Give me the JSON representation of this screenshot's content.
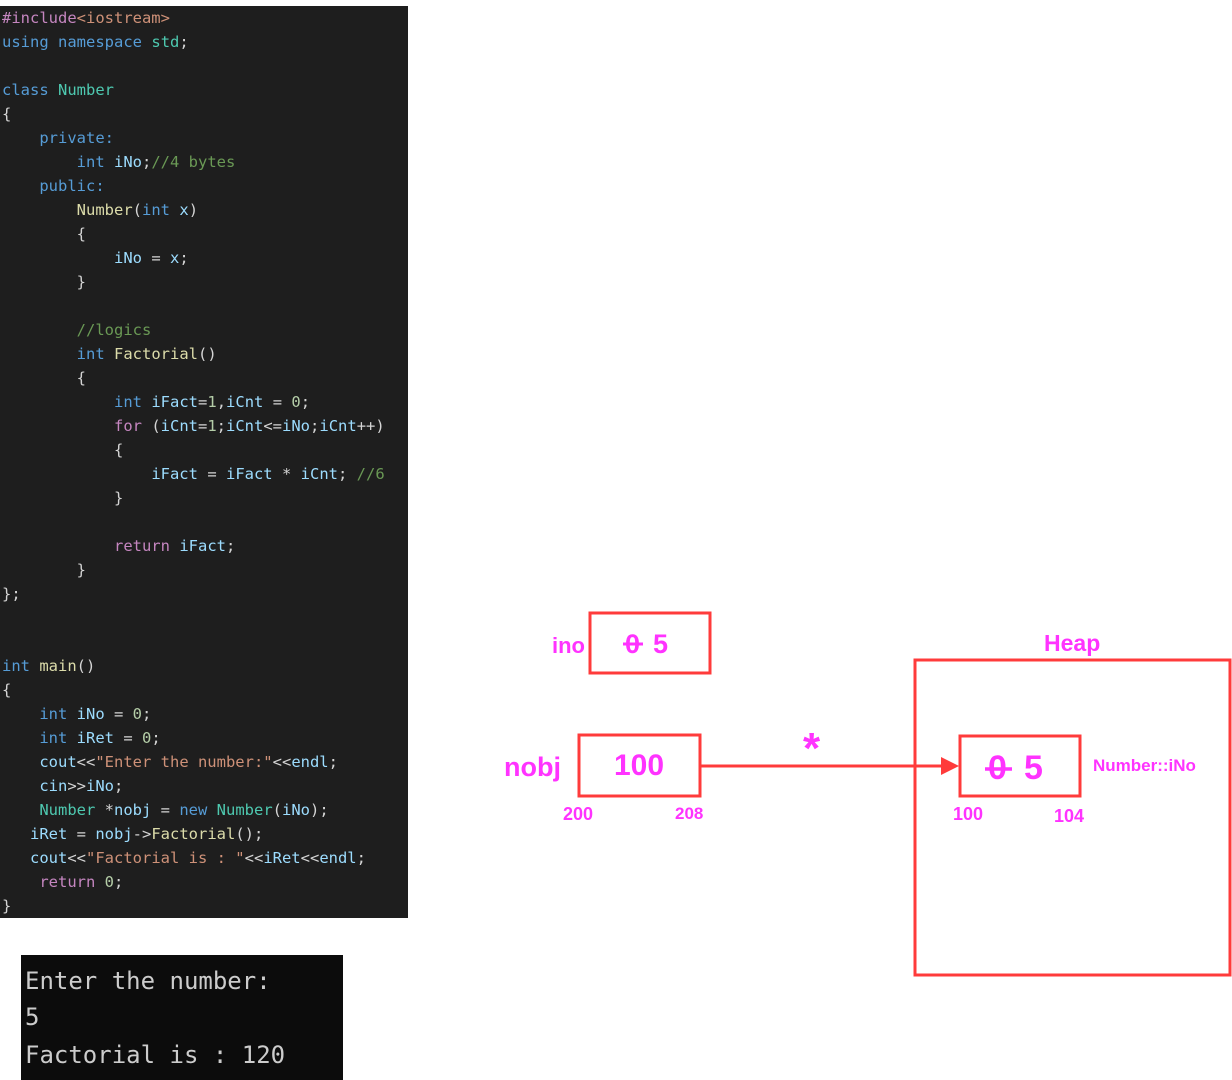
{
  "colors": {
    "editor_background": "#1e1e1e",
    "console_background": "#0c0c0c",
    "box_stroke": "#ff3b3b",
    "arrow": "#ff3b3b",
    "diagram_text": "#ff33ff"
  },
  "code": {
    "lines": [
      [
        [
          "pp",
          "#include"
        ],
        [
          "str",
          "<iostream>"
        ]
      ],
      [
        [
          "kw",
          "using"
        ],
        [
          "pl",
          " "
        ],
        [
          "kw",
          "namespace"
        ],
        [
          "pl",
          " "
        ],
        [
          "ty",
          "std"
        ],
        [
          "pl",
          ";"
        ]
      ],
      [],
      [
        [
          "kw",
          "class"
        ],
        [
          "pl",
          " "
        ],
        [
          "ty",
          "Number"
        ]
      ],
      [
        [
          "pl",
          "{"
        ]
      ],
      [
        [
          "pl",
          "    "
        ],
        [
          "kw",
          "private:"
        ]
      ],
      [
        [
          "pl",
          "        "
        ],
        [
          "kw",
          "int"
        ],
        [
          "pl",
          " "
        ],
        [
          "var",
          "iNo"
        ],
        [
          "pl",
          ";"
        ],
        [
          "cm",
          "//4 bytes"
        ]
      ],
      [
        [
          "pl",
          "    "
        ],
        [
          "kw",
          "public:"
        ]
      ],
      [
        [
          "pl",
          "        "
        ],
        [
          "fn",
          "Number"
        ],
        [
          "pl",
          "("
        ],
        [
          "kw",
          "int"
        ],
        [
          "pl",
          " "
        ],
        [
          "var",
          "x"
        ],
        [
          "pl",
          ")"
        ]
      ],
      [
        [
          "pl",
          "        {"
        ]
      ],
      [
        [
          "pl",
          "            "
        ],
        [
          "var",
          "iNo"
        ],
        [
          "pl",
          " = "
        ],
        [
          "var",
          "x"
        ],
        [
          "pl",
          ";"
        ]
      ],
      [
        [
          "pl",
          "        }"
        ]
      ],
      [],
      [
        [
          "pl",
          "        "
        ],
        [
          "cm",
          "//logics"
        ]
      ],
      [
        [
          "pl",
          "        "
        ],
        [
          "kw",
          "int"
        ],
        [
          "pl",
          " "
        ],
        [
          "fn",
          "Factorial"
        ],
        [
          "pl",
          "()"
        ]
      ],
      [
        [
          "pl",
          "        {"
        ]
      ],
      [
        [
          "pl",
          "            "
        ],
        [
          "kw",
          "int"
        ],
        [
          "pl",
          " "
        ],
        [
          "var",
          "iFact"
        ],
        [
          "pl",
          "="
        ],
        [
          "num",
          "1"
        ],
        [
          "pl",
          ","
        ],
        [
          "var",
          "iCnt"
        ],
        [
          "pl",
          " = "
        ],
        [
          "num",
          "0"
        ],
        [
          "pl",
          ";"
        ]
      ],
      [
        [
          "pl",
          "            "
        ],
        [
          "ctl",
          "for"
        ],
        [
          "pl",
          " ("
        ],
        [
          "var",
          "iCnt"
        ],
        [
          "pl",
          "="
        ],
        [
          "num",
          "1"
        ],
        [
          "pl",
          ";"
        ],
        [
          "var",
          "iCnt"
        ],
        [
          "pl",
          "<="
        ],
        [
          "var",
          "iNo"
        ],
        [
          "pl",
          ";"
        ],
        [
          "var",
          "iCnt"
        ],
        [
          "pl",
          "++)"
        ]
      ],
      [
        [
          "pl",
          "            {"
        ]
      ],
      [
        [
          "pl",
          "                "
        ],
        [
          "var",
          "iFact"
        ],
        [
          "pl",
          " = "
        ],
        [
          "var",
          "iFact"
        ],
        [
          "pl",
          " * "
        ],
        [
          "var",
          "iCnt"
        ],
        [
          "pl",
          "; "
        ],
        [
          "cm",
          "//6"
        ]
      ],
      [
        [
          "pl",
          "            }"
        ]
      ],
      [],
      [
        [
          "pl",
          "            "
        ],
        [
          "ctl",
          "return"
        ],
        [
          "pl",
          " "
        ],
        [
          "var",
          "iFact"
        ],
        [
          "pl",
          ";"
        ]
      ],
      [
        [
          "pl",
          "        }"
        ]
      ],
      [
        [
          "pl",
          "};"
        ]
      ],
      [],
      [],
      [
        [
          "kw",
          "int"
        ],
        [
          "pl",
          " "
        ],
        [
          "fn",
          "main"
        ],
        [
          "pl",
          "()"
        ]
      ],
      [
        [
          "pl",
          "{"
        ]
      ],
      [
        [
          "pl",
          "    "
        ],
        [
          "kw",
          "int"
        ],
        [
          "pl",
          " "
        ],
        [
          "var",
          "iNo"
        ],
        [
          "pl",
          " = "
        ],
        [
          "num",
          "0"
        ],
        [
          "pl",
          ";"
        ]
      ],
      [
        [
          "pl",
          "    "
        ],
        [
          "kw",
          "int"
        ],
        [
          "pl",
          " "
        ],
        [
          "var",
          "iRet"
        ],
        [
          "pl",
          " = "
        ],
        [
          "num",
          "0"
        ],
        [
          "pl",
          ";"
        ]
      ],
      [
        [
          "pl",
          "    "
        ],
        [
          "var",
          "cout"
        ],
        [
          "pl",
          "<<"
        ],
        [
          "str",
          "\"Enter the number:\""
        ],
        [
          "pl",
          "<<"
        ],
        [
          "var",
          "endl"
        ],
        [
          "pl",
          ";"
        ]
      ],
      [
        [
          "pl",
          "    "
        ],
        [
          "var",
          "cin"
        ],
        [
          "pl",
          ">>"
        ],
        [
          "var",
          "iNo"
        ],
        [
          "pl",
          ";"
        ]
      ],
      [
        [
          "pl",
          "    "
        ],
        [
          "ty",
          "Number"
        ],
        [
          "pl",
          " *"
        ],
        [
          "var",
          "nobj"
        ],
        [
          "pl",
          " = "
        ],
        [
          "kw",
          "new"
        ],
        [
          "pl",
          " "
        ],
        [
          "ty",
          "Number"
        ],
        [
          "pl",
          "("
        ],
        [
          "var",
          "iNo"
        ],
        [
          "pl",
          ");"
        ]
      ],
      [
        [
          "pl",
          "   "
        ],
        [
          "var",
          "iRet"
        ],
        [
          "pl",
          " = "
        ],
        [
          "var",
          "nobj"
        ],
        [
          "pl",
          "->"
        ],
        [
          "fn",
          "Factorial"
        ],
        [
          "pl",
          "();"
        ]
      ],
      [
        [
          "pl",
          "   "
        ],
        [
          "var",
          "cout"
        ],
        [
          "pl",
          "<<"
        ],
        [
          "str",
          "\"Factorial is : \""
        ],
        [
          "pl",
          "<<"
        ],
        [
          "var",
          "iRet"
        ],
        [
          "pl",
          "<<"
        ],
        [
          "var",
          "endl"
        ],
        [
          "pl",
          ";"
        ]
      ],
      [
        [
          "pl",
          "    "
        ],
        [
          "ctl",
          "return"
        ],
        [
          "pl",
          " "
        ],
        [
          "num",
          "0"
        ],
        [
          "pl",
          ";"
        ]
      ],
      [
        [
          "pl",
          "}"
        ]
      ]
    ]
  },
  "console": {
    "line1": "Enter the number:",
    "line2": "5",
    "line3": "Factorial is : 120"
  },
  "diagram": {
    "ino": {
      "label": "ino",
      "old_value": "0",
      "new_value": "5"
    },
    "nobj": {
      "label": "nobj",
      "value": "100",
      "addr_start": "200",
      "addr_end": "208"
    },
    "pointer_symbol": "*",
    "heap": {
      "label": "Heap",
      "member_old_value": "0",
      "member_new_value": "5",
      "member_label": "Number::iNo",
      "addr_start": "100",
      "addr_end": "104"
    }
  }
}
